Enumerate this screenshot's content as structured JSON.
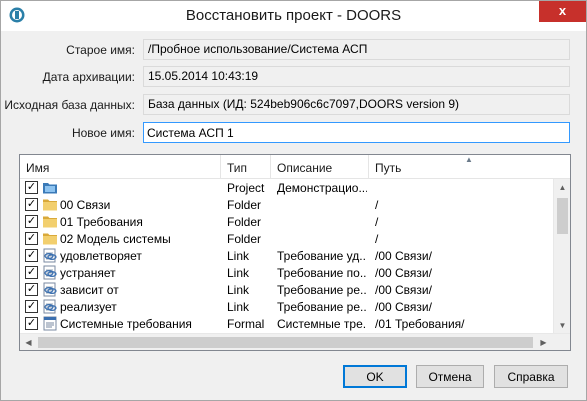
{
  "window": {
    "title": "Восстановить проект - DOORS",
    "close_glyph": "x"
  },
  "form": {
    "old_name_label": "Старое имя:",
    "old_name_value": "/Пробное использование/Система АСП",
    "archive_date_label": "Дата архивации:",
    "archive_date_value": "15.05.2014 10:43:19",
    "source_db_label": "Исходная база данных:",
    "source_db_value": "База данных (ИД: 524beb906c6c7097,DOORS version 9)",
    "new_name_label": "Новое имя:",
    "new_name_value": "Система АСП 1"
  },
  "list": {
    "columns": [
      "Имя",
      "Тип",
      "Описание",
      "Путь"
    ],
    "sort_indicator": "▲",
    "rows": [
      {
        "checked": true,
        "icon": "project-icon",
        "name": "",
        "type": "Project",
        "description": "Демонстрацио...",
        "path": ""
      },
      {
        "checked": true,
        "icon": "folder-icon",
        "name": "00 Связи",
        "type": "Folder",
        "description": "",
        "path": "/"
      },
      {
        "checked": true,
        "icon": "folder-icon",
        "name": "01 Требования",
        "type": "Folder",
        "description": "",
        "path": "/"
      },
      {
        "checked": true,
        "icon": "folder-icon",
        "name": "02 Модель системы",
        "type": "Folder",
        "description": "",
        "path": "/"
      },
      {
        "checked": true,
        "icon": "link-module-icon",
        "name": "удовлетворяет",
        "type": "Link",
        "description": "Требование уд...",
        "path": "/00 Связи/"
      },
      {
        "checked": true,
        "icon": "link-module-icon",
        "name": "устраняет",
        "type": "Link",
        "description": "Требование по...",
        "path": "/00 Связи/"
      },
      {
        "checked": true,
        "icon": "link-module-icon",
        "name": "зависит от",
        "type": "Link",
        "description": "Требование ре...",
        "path": "/00 Связи/"
      },
      {
        "checked": true,
        "icon": "link-module-icon",
        "name": "реализует",
        "type": "Link",
        "description": "Требование ре...",
        "path": "/00 Связи/"
      },
      {
        "checked": true,
        "icon": "formal-module-icon",
        "name": "Системные требования",
        "type": "Formal",
        "description": "Системные тре...",
        "path": "/01 Требования/"
      }
    ]
  },
  "buttons": {
    "ok": "OK",
    "cancel": "Отмена",
    "help": "Справка"
  },
  "colors": {
    "close_button": "#c7302b",
    "focus_border": "#3399ff",
    "folder": "#e8c15a"
  }
}
